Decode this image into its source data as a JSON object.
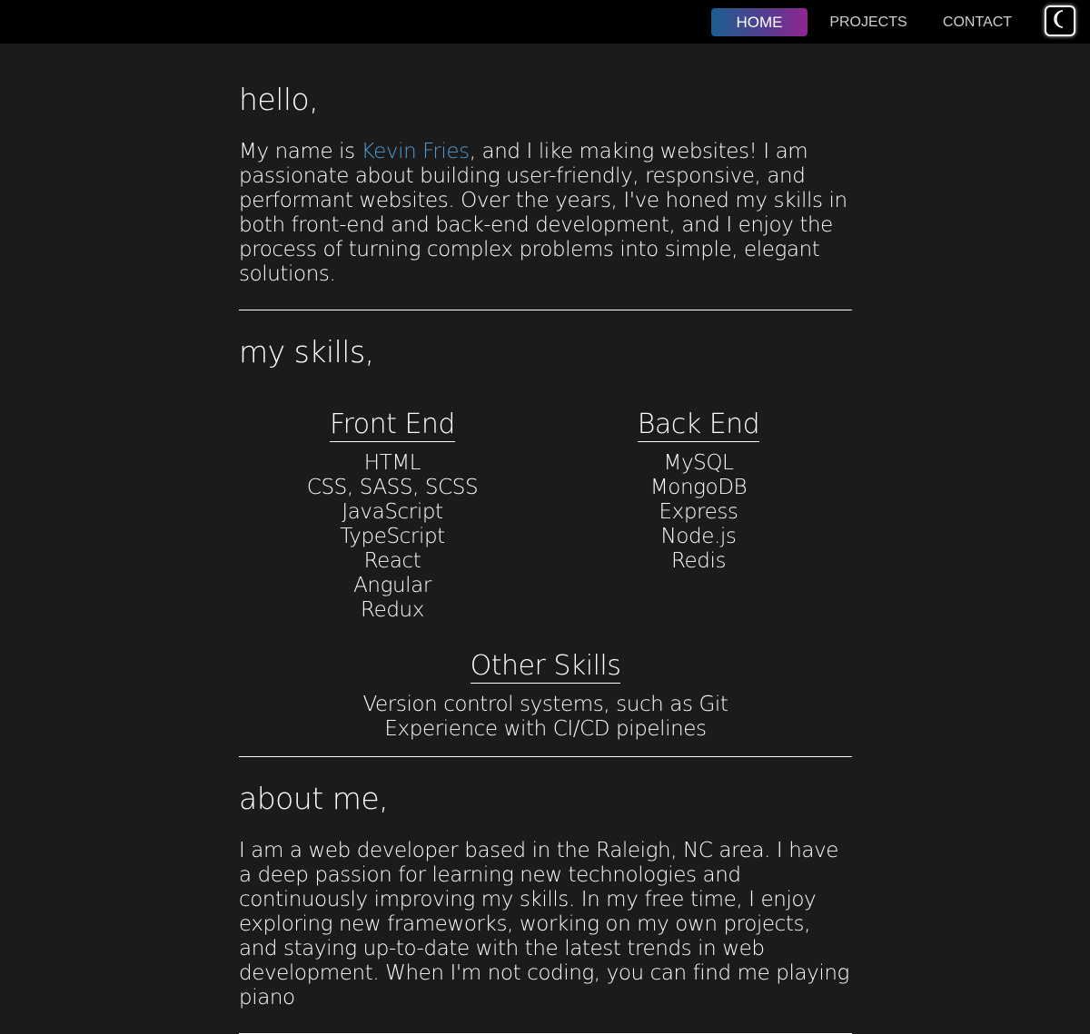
{
  "nav": {
    "home": "HOME",
    "projects": "PROJECTS",
    "contact": "CONTACT",
    "theme_icon": "moon-icon",
    "active_gradient": [
      "#1c5f8f",
      "#8e2690"
    ]
  },
  "hello": {
    "title": "hello,",
    "intro_prefix": "My name is ",
    "name_link": "Kevin Fries",
    "intro_suffix": ", and I like making websites! I am passionate about building user-friendly, responsive, and performant websites. Over the years, I've honed my skills in both front-end and back-end development, and I enjoy the process of turning complex problems into simple, elegant solutions."
  },
  "skills": {
    "title": "my skills,",
    "front_end": {
      "heading": "Front End",
      "items": [
        "HTML",
        "CSS, SASS, SCSS",
        "JavaScript",
        "TypeScript",
        "React",
        "Angular",
        "Redux"
      ]
    },
    "back_end": {
      "heading": "Back End",
      "items": [
        "MySQL",
        "MongoDB",
        "Express",
        "Node.js",
        "Redis"
      ]
    },
    "other": {
      "heading": "Other Skills",
      "items": [
        "Version control systems, such as Git",
        "Experience with CI/CD pipelines"
      ]
    }
  },
  "about": {
    "title": "about me,",
    "text": "I am a web developer based in the Raleigh, NC area. I have a deep passion for learning new technologies and continuously improving my skills. In my free time, I enjoy exploring new frameworks, working on my own projects, and staying up-to-date with the latest trends in web development. When I'm not coding, you can find me playing piano"
  },
  "colors": {
    "background": "#1b1b1b",
    "navbar": "#000000",
    "accent_link": "#4d9cd6"
  }
}
